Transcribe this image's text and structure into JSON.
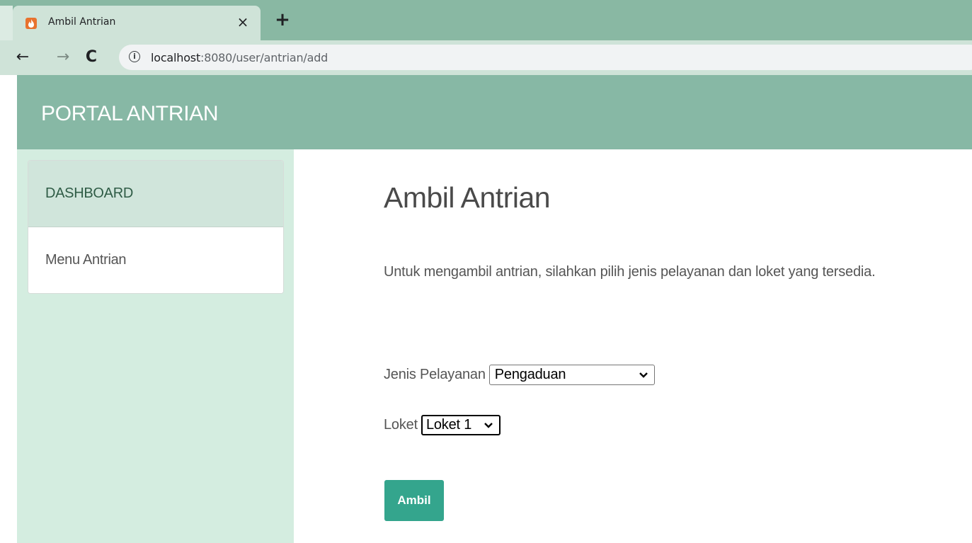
{
  "browser": {
    "tab_title": "Ambil Antrian",
    "tab_close": "×",
    "new_tab": "+",
    "favicon": "codeigniter-flame-icon",
    "back": "←",
    "forward": "→",
    "reload": "C",
    "info": "i",
    "url_host": "localhost",
    "url_rest": ":8080/user/antrian/add"
  },
  "header": {
    "brand": "PORTAL ANTRIAN"
  },
  "sidebar": {
    "items": [
      {
        "label": "DASHBOARD",
        "active": true
      },
      {
        "label": "Menu Antrian",
        "active": false
      }
    ]
  },
  "content": {
    "title": "Ambil Antrian",
    "description": "Untuk mengambil antrian, silahkan pilih jenis pelayanan dan loket yang tersedia.",
    "jenis_label": "Jenis Pelayanan",
    "jenis_value": "Pengaduan",
    "loket_label": "Loket",
    "loket_value": "Loket 1",
    "submit_label": "Ambil"
  },
  "colors": {
    "header": "#87b8a5",
    "sidebar": "#d4ede0",
    "button": "#34a58d"
  }
}
